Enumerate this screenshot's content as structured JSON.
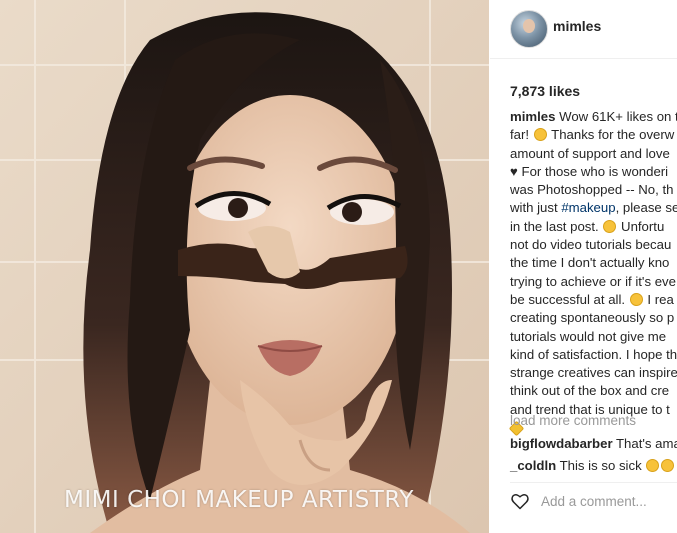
{
  "photo": {
    "alt": "Mimi Choi makeup illusion portrait",
    "watermark": "MIMI CHOI MAKEUP ARTISTRY"
  },
  "post": {
    "username": "mimles",
    "likes": "7,873 likes",
    "caption": {
      "l1_user": "mimles",
      "l1": " Wow 61K+ likes on t",
      "l2a": "far!",
      "l2b": " Thanks for the overw",
      "l3": "amount of support and love",
      "l4": " For those who is wonderi",
      "l5": "was Photoshopped -- No, th",
      "l6a": "with just ",
      "l6_tag": "#makeup",
      "l6b": ", please se",
      "l7a": "in the last post.",
      "l7b": " Unfortu",
      "l8": "not do video tutorials becau",
      "l9": "the time I don't actually kno",
      "l10": "trying to achieve or if it's eve",
      "l11a": "be successful at all.",
      "l11b": " I rea",
      "l12": "creating spontaneously so p",
      "l13": "tutorials would not give me",
      "l14": "kind of satisfaction. I hope th",
      "l15": "strange creatives can inspire",
      "l16": "think out of the box and cre",
      "l17": "and trend that is unique to t"
    },
    "load_more": "load more comments",
    "comments": [
      {
        "user": "bigflowdabarber",
        "text": " That's ama"
      },
      {
        "user": "_coldln",
        "text": " This is so sick "
      }
    ],
    "add_comment_placeholder": "Add a comment..."
  },
  "icons": {
    "heart": "heart-outline-icon",
    "emoji": "emoji-icon"
  }
}
